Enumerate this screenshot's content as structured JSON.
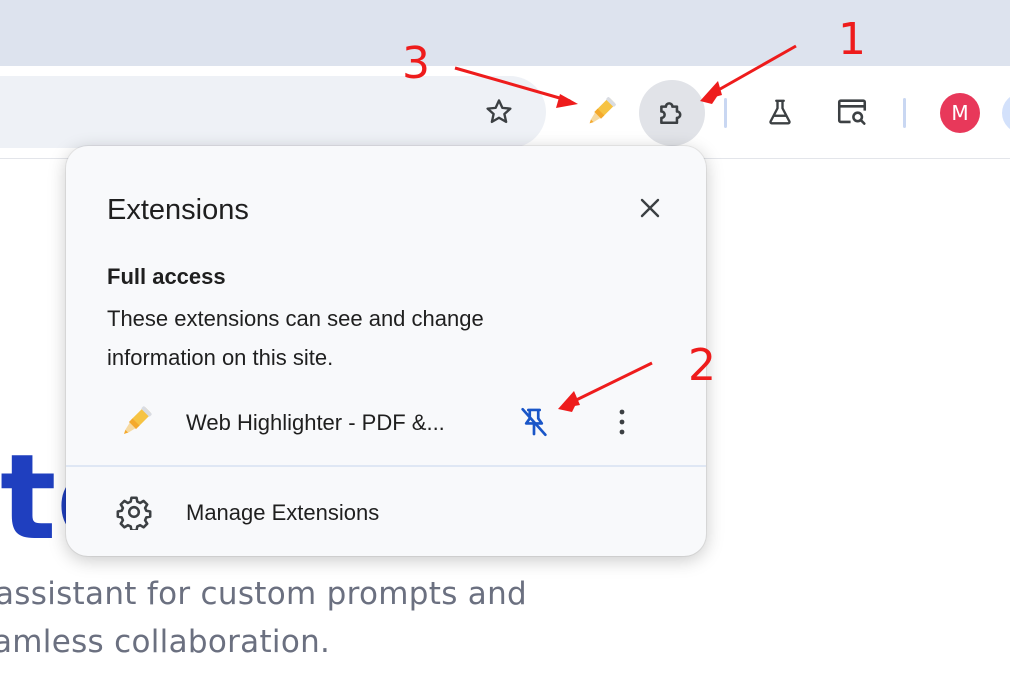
{
  "browser": {
    "toolbar": {
      "bookmark_icon": "star-outline-icon",
      "pinned_extension_icon": "highlighter-pen-icon",
      "extensions_icon": "puzzle-piece-icon",
      "labs_icon": "flask-icon",
      "search_tabs_icon": "tab-search-icon",
      "profile_initial": "M",
      "profile_color": "#e8385a"
    }
  },
  "page_content": {
    "hero_fragment": "te",
    "tagline_lines": [
      "assistant for custom prompts and",
      "amless collaboration."
    ]
  },
  "popup": {
    "title": "Extensions",
    "close_icon": "close-icon",
    "section_heading": "Full access",
    "section_description": "These extensions can see and change information on this site.",
    "extensions": [
      {
        "name": "Web Highlighter - PDF &...",
        "icon": "highlighter-pen-icon",
        "pin_icon": "unpin-icon",
        "menu_icon": "more-vert-icon"
      }
    ],
    "manage_label": "Manage Extensions",
    "manage_icon": "gear-icon"
  },
  "annotations": {
    "labels": [
      "1",
      "2",
      "3"
    ],
    "color": "#ee1c1c"
  }
}
